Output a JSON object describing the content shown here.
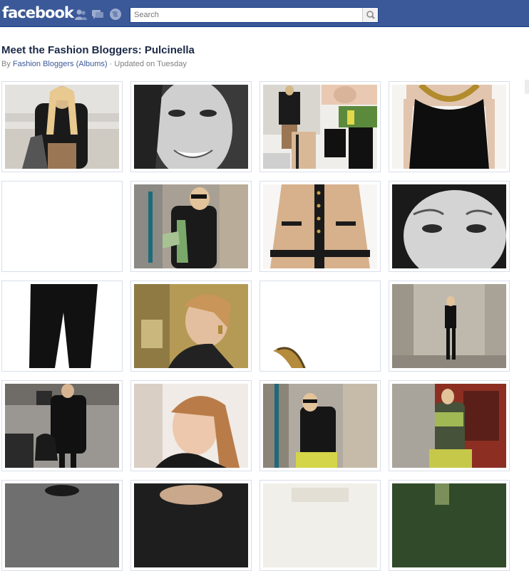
{
  "header": {
    "logo_text": "facebook",
    "search_placeholder": "Search",
    "brand_color": "#3b5998",
    "icons": [
      "friend-requests-icon",
      "messages-icon",
      "notifications-icon",
      "search-icon"
    ]
  },
  "album": {
    "title": "Meet the Fashion Bloggers: Pulcinella",
    "by_label": "By",
    "author": "Fashion Bloggers (Albums)",
    "separator": "·",
    "updated": "Updated on Tuesday"
  }
}
